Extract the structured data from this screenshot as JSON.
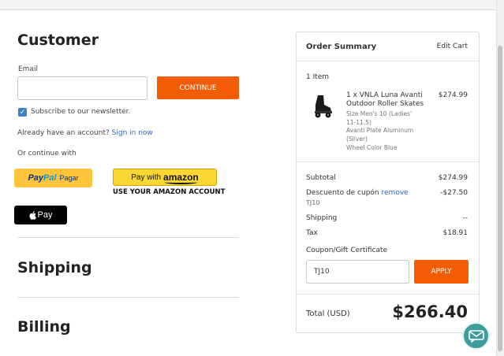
{
  "customer": {
    "title": "Customer",
    "email_label": "Email",
    "email_value": "",
    "continue_label": "CONTINUE",
    "newsletter_label": "Subscribe to our newsletter.",
    "newsletter_checked": true,
    "account_prompt": "Already have an account?",
    "sign_in_link": "Sign in now",
    "or_continue": "Or continue with"
  },
  "payments": {
    "paypal_part1": "Pay",
    "paypal_part2": "Pal",
    "paypal_suffix": "Pagar",
    "amazon_prefix": "Pay with",
    "amazon_brand": "amazon",
    "amazon_sub": "USE YOUR AMAZON ACCOUNT",
    "applepay_label": "Pay"
  },
  "sections": {
    "shipping_title": "Shipping",
    "billing_title": "Billing"
  },
  "summary": {
    "title": "Order Summary",
    "edit_cart": "Edit Cart",
    "item_count": "1 Item",
    "item": {
      "name": "1 x VNLA Luna Avanti Outdoor Roller Skates",
      "price": "$274.99",
      "size": "Size Men's 10 (Ladies' 11-11.5)",
      "plate": "Avanti Plate Aluminum (Silver)",
      "wheel": "Wheel Color Blue"
    },
    "subtotal_label": "Subtotal",
    "subtotal_value": "$274.99",
    "discount_label": "Descuento de cupón",
    "discount_remove": "remove",
    "discount_code": "TJ10",
    "discount_value": "-$27.50",
    "shipping_label": "Shipping",
    "shipping_value": "--",
    "tax_label": "Tax",
    "tax_value": "$18.91",
    "coupon_label": "Coupon/Gift Certificate",
    "coupon_value": "TJ10",
    "apply_label": "APPLY",
    "total_label": "Total (USD)",
    "total_value": "$266.40"
  },
  "colors": {
    "accent": "#f25c05",
    "link": "#2a6bc4",
    "chat": "#3e9c9c"
  }
}
